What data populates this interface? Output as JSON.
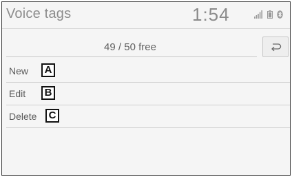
{
  "status_bar": {
    "title": "Voice tags",
    "time": "1:54",
    "icons": [
      "signal-icon",
      "battery-icon",
      "bluetooth-icon"
    ]
  },
  "counter": {
    "text": "49 / 50 free"
  },
  "back_button": {
    "icon": "back-arrow-icon"
  },
  "menu": [
    {
      "label": "New",
      "callout": "A"
    },
    {
      "label": "Edit",
      "callout": "B"
    },
    {
      "label": "Delete",
      "callout": "C"
    }
  ],
  "colors": {
    "background": "#f5f5f5",
    "text": "#5a5a5a",
    "divider": "#cfcfcf"
  }
}
